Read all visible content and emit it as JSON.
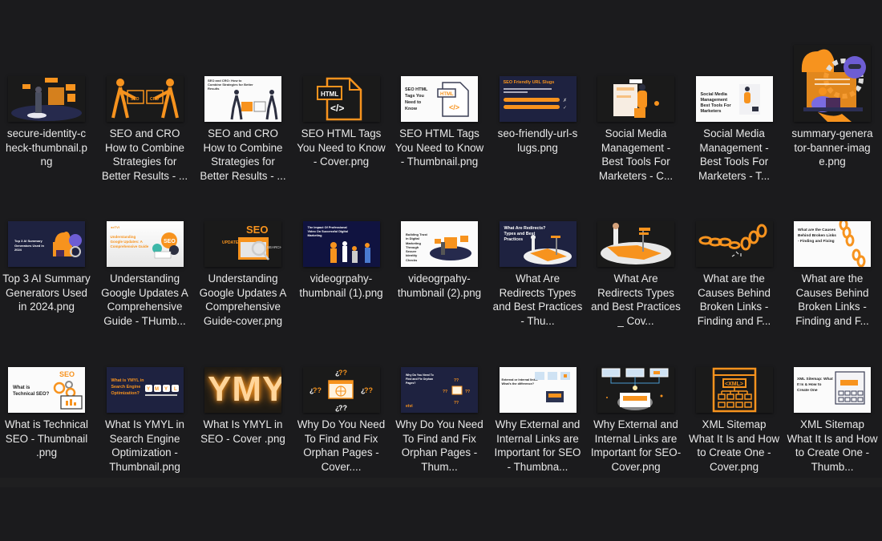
{
  "window": {
    "view": "large-icons",
    "background": "#1b1b1d"
  },
  "accent": "#f7931e",
  "files": [
    {
      "name": "secure-identity-check-thumbnail.png",
      "label": "secure-identity-c heck-thumbnail.p ng",
      "thumb": "secure-identity"
    },
    {
      "name": "SEO and CRO How to Combine Strategies for Better Results - Cover.png",
      "label": "SEO and CRO How to Combine Strategies for Better Results - ...",
      "thumb": "seo-cro-dark"
    },
    {
      "name": "SEO and CRO How to Combine Strategies for Better Results - Thumbnail.png",
      "label": "SEO and CRO How to Combine Strategies for Better Results - ...",
      "thumb": "seo-cro-white",
      "thumb_text": "SEO and CRO: How to Combine Strategies for Better Results"
    },
    {
      "name": "SEO HTML Tags You Need to Know - Cover.png",
      "label": "SEO HTML Tags You Need to Know - Cover.png",
      "thumb": "html-dark",
      "thumb_text": "HTML"
    },
    {
      "name": "SEO HTML Tags You Need to Know - Thumbnail.png",
      "label": "SEO HTML Tags You Need to Know - Thumbnail.png",
      "thumb": "html-white",
      "thumb_text": "SEO HTML Tags You Need to Know"
    },
    {
      "name": "seo-friendly-url-slugs.png",
      "label": "seo-friendly-url-s lugs.png",
      "thumb": "url-slugs",
      "thumb_text": "SEO Friendly URL Slugs"
    },
    {
      "name": "Social Media Management - Best Tools For Marketers - Cover.png",
      "label": "Social Media Management - Best Tools For Marketers - C...",
      "thumb": "social-dark"
    },
    {
      "name": "Social Media Management - Best Tools For Marketers - Thumbnail.png",
      "label": "Social Media Management - Best Tools For Marketers - T...",
      "thumb": "social-white",
      "thumb_text": "Social Media Management Best Tools For Marketers"
    },
    {
      "name": "summary-generator-banner-image.png",
      "label": "summary-genera tor-banner-imag e.png",
      "thumb": "summary-banner"
    },
    {
      "name": "Top 3 AI Summary Generators Used in 2024.png",
      "label": "Top 3 AI Summary Generators Used in 2024.png",
      "thumb": "top3-ai",
      "thumb_text": "Top 3 AI Summary Generators Used in 2024"
    },
    {
      "name": "Understanding Google Updates A Comprehensive Guide - THumbnail.png",
      "label": "Understanding Google Updates A Comprehensive Guide - THumb...",
      "thumb": "google-white",
      "thumb_text": "Understanding Google Updates: A Comprehensive Guide"
    },
    {
      "name": "Understanding Google Updates A Comprehensive Guide-cover.png",
      "label": "Understanding Google Updates A Comprehensive Guide-cover.png",
      "thumb": "google-dark",
      "thumb_text": "SEO"
    },
    {
      "name": "videogrpahy-thumbnail (1).png",
      "label": "videogrpahy- thumbnail (1).png",
      "thumb": "video-1",
      "thumb_text": "The Impact Of Professional Video On Successful Digital Marketing"
    },
    {
      "name": "videogrpahy-thumbnail (2).png",
      "label": "videogrpahy- thumbnail (2).png",
      "thumb": "video-2",
      "thumb_text": "Building Trust in Digital Marketing Through Secure Identity Checks"
    },
    {
      "name": "What Are Redirects Types and Best Practices - Thumbnail.png",
      "label": "What Are Redirects Types and Best Practices - Thu...",
      "thumb": "redirects-navy",
      "thumb_text": "What Are Redirects? Types and Best Practices"
    },
    {
      "name": "What Are Redirects Types and Best Practices _ Cover.png",
      "label": "What Are Redirects Types and Best Practices _ Cov...",
      "thumb": "redirects-dark"
    },
    {
      "name": "What are the Causes Behind Broken Links - Finding and Fixing - Cover.png",
      "label": "What are the Causes Behind Broken Links - Finding and F...",
      "thumb": "broken-dark"
    },
    {
      "name": "What are the Causes Behind Broken Links - Finding and Fixing - Thumbnail.png",
      "label": "What are the Causes Behind Broken Links - Finding and F...",
      "thumb": "broken-white",
      "thumb_text": "What are the Causes Behind Broken Links - Finding and Fixing"
    },
    {
      "name": "What is Technical SEO - Thumbnail .png",
      "label": "What is Technical SEO - Thumbnail .png",
      "thumb": "tech-seo",
      "thumb_text": "What is Technical SEO?"
    },
    {
      "name": "What Is YMYL in Search Engine Optimization - Thumbnail.png",
      "label": "What Is YMYL in Search Engine Optimization - Thumbnail.png",
      "thumb": "ymyl-navy",
      "thumb_text": "What is YMYL in Search Engine Optimization?"
    },
    {
      "name": "What Is YMYL in SEO - Cover .png",
      "label": "What Is YMYL in SEO - Cover .png",
      "thumb": "ymyl-dark",
      "thumb_text": "YMYL"
    },
    {
      "name": "Why Do You Need To Find and Fix Orphan Pages - Cover.png",
      "label": "Why Do You Need To Find and Fix Orphan Pages - Cover....",
      "thumb": "orphan-dark"
    },
    {
      "name": "Why Do You Need To Find and Fix Orphan Pages - Thumbnail.png",
      "label": "Why Do You Need To Find and Fix Orphan Pages - Thum...",
      "thumb": "orphan-navy",
      "thumb_text": "Why Do You Need To Find and Fix Orphan Pages?"
    },
    {
      "name": "Why External and Internal Links are Important for SEO - Thumbnail.png",
      "label": "Why External and Internal Links are Important for SEO - Thumbna...",
      "thumb": "links-white",
      "thumb_text": "External or Internal links: What's the difference?"
    },
    {
      "name": "Why External and Internal Links are Important for SEO- Cover.png",
      "label": "Why External and Internal Links are Important for SEO- Cover.png",
      "thumb": "links-dark"
    },
    {
      "name": "XML Sitemap What It Is and How to Create One - Cover.png",
      "label": "XML Sitemap What It Is and How to Create One - Cover.png",
      "thumb": "xml-dark",
      "thumb_text": "<XML>"
    },
    {
      "name": "XML Sitemap What It Is and How to Create One - Thumbnail.png",
      "label": "XML Sitemap What It Is and How to Create One - Thumb...",
      "thumb": "xml-white",
      "thumb_text": "XML Sitemap: What It Is & How to Create One"
    }
  ]
}
